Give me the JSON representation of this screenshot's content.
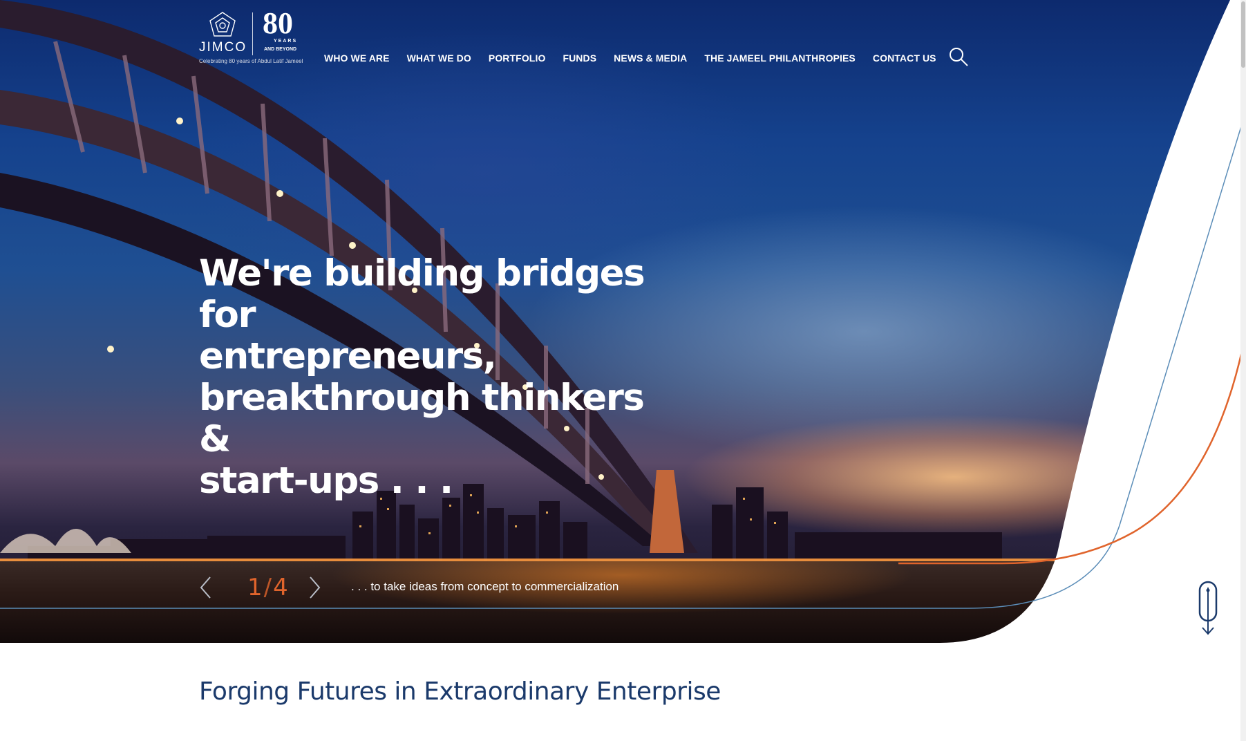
{
  "logo": {
    "brand_text": "JIMCO",
    "anniversary_number": "80",
    "anniversary_years": "YEARS",
    "anniversary_beyond": "AND BEYOND",
    "tagline": "Celebrating 80 years of Abdul Latif Jameel"
  },
  "nav": {
    "items": [
      {
        "label": "WHO WE ARE"
      },
      {
        "label": "WHAT WE DO"
      },
      {
        "label": "PORTFOLIO"
      },
      {
        "label": "FUNDS"
      },
      {
        "label": "NEWS & MEDIA"
      },
      {
        "label": "THE JAMEEL PHILANTHROPIES"
      },
      {
        "label": "CONTACT US"
      }
    ],
    "search_icon": "search-icon"
  },
  "hero": {
    "headline_lines": [
      "We're building bridges for",
      "entrepreneurs,",
      "breakthrough thinkers &",
      "start-ups . . ."
    ],
    "slide_current": "1",
    "slide_separator": "/",
    "slide_total": "4",
    "caption": ". . . to take ideas from concept to commercialization",
    "prev_icon": "chevron-left-icon",
    "next_icon": "chevron-right-icon",
    "scroll_icon": "scroll-down-icon"
  },
  "section": {
    "title": "Forging Futures in Extraordinary Enterprise"
  },
  "colors": {
    "accent_orange": "#e0642c",
    "navy": "#1b3a6b",
    "line_blue": "#5b8db8"
  }
}
